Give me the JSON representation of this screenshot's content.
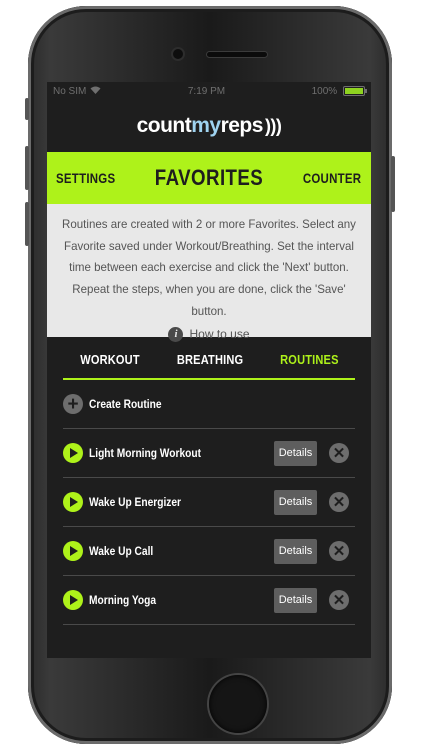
{
  "status_bar": {
    "carrier": "No SIM",
    "time": "7:19 PM",
    "battery": "100%",
    "battery_level": 1.0
  },
  "app": {
    "logo_part1": "count",
    "logo_part2": "my",
    "logo_part3": "reps"
  },
  "header": {
    "left": "SETTINGS",
    "title": "FAVORITES",
    "right": "COUNTER"
  },
  "info": {
    "text": "Routines are created with 2 or more Favorites. Select any Favorite saved under Workout/Breathing. Set the interval time between each exercise and click the 'Next' button. Repeat the steps, when you are done, click the 'Save' button.",
    "howto": "How to use"
  },
  "tabs": [
    {
      "label": "WORKOUT"
    },
    {
      "label": "BREATHING"
    },
    {
      "label": "ROUTINES"
    }
  ],
  "create_label": "Create Routine",
  "details_label": "Details",
  "routines": [
    {
      "name": "Light Morning Workout"
    },
    {
      "name": "Wake Up Energizer"
    },
    {
      "name": "Wake Up Call"
    },
    {
      "name": "Morning Yoga"
    }
  ],
  "colors": {
    "accent": "#aef21a",
    "screen_bg": "#1e1e1e",
    "info_bg": "#e8e8e8"
  }
}
